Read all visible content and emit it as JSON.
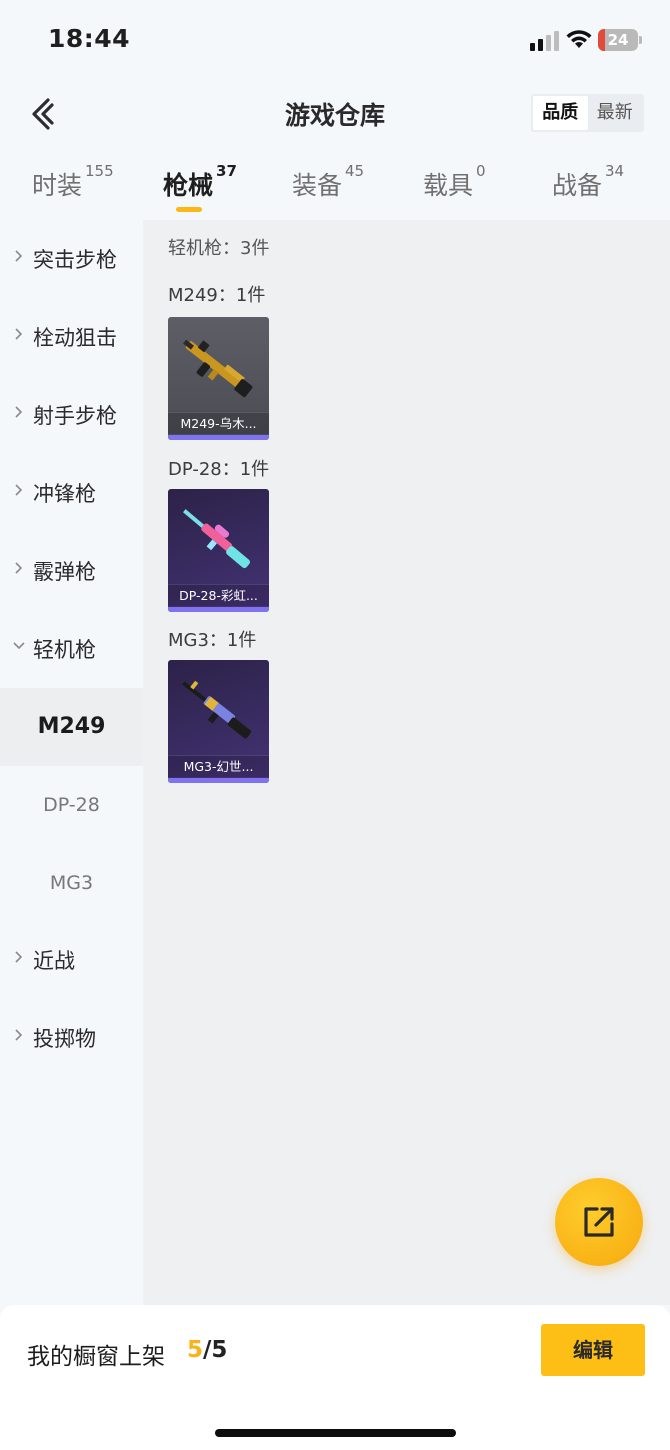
{
  "status_bar": {
    "time": "18:44",
    "battery": "24"
  },
  "header": {
    "title": "游戏仓库",
    "sort_options": [
      "品质",
      "最新"
    ],
    "sort_selected": "品质"
  },
  "tabs": [
    {
      "label": "时装",
      "count": "155"
    },
    {
      "label": "枪械",
      "count": "37",
      "active": true
    },
    {
      "label": "装备",
      "count": "45"
    },
    {
      "label": "载具",
      "count": "0"
    },
    {
      "label": "战备",
      "count": "34"
    }
  ],
  "sidebar": {
    "categories": [
      "突击步枪",
      "栓动狙击",
      "射手步枪",
      "冲锋枪",
      "霰弹枪",
      "轻机枪"
    ],
    "expanded_subitems": [
      "M249",
      "DP-28",
      "MG3"
    ],
    "active_subitem": "M249",
    "categories_after": [
      "近战",
      "投掷物"
    ]
  },
  "content": {
    "group_title": "轻机枪：3件",
    "subgroups": [
      {
        "title": "M249：1件",
        "item_name": "M249-乌木...",
        "card_style": "grey"
      },
      {
        "title": "DP-28：1件",
        "item_name": "DP-28-彩虹...",
        "card_style": "purple"
      },
      {
        "title": "MG3：1件",
        "item_name": "MG3-幻世...",
        "card_style": "purple"
      }
    ]
  },
  "bottom_bar": {
    "label": "我的橱窗上架",
    "shelved": "5",
    "separator": "/",
    "capacity": "5",
    "edit_label": "编辑"
  },
  "colors": {
    "accent": "#fbb716",
    "rarity_purple": "#7f73ef",
    "active_tab_text": "#1f1f1f"
  },
  "icons": {
    "back": "chevron-left-icon",
    "fab": "share-external-icon",
    "category_collapsed": "chevron-right-icon",
    "category_expanded": "chevron-down-icon"
  }
}
